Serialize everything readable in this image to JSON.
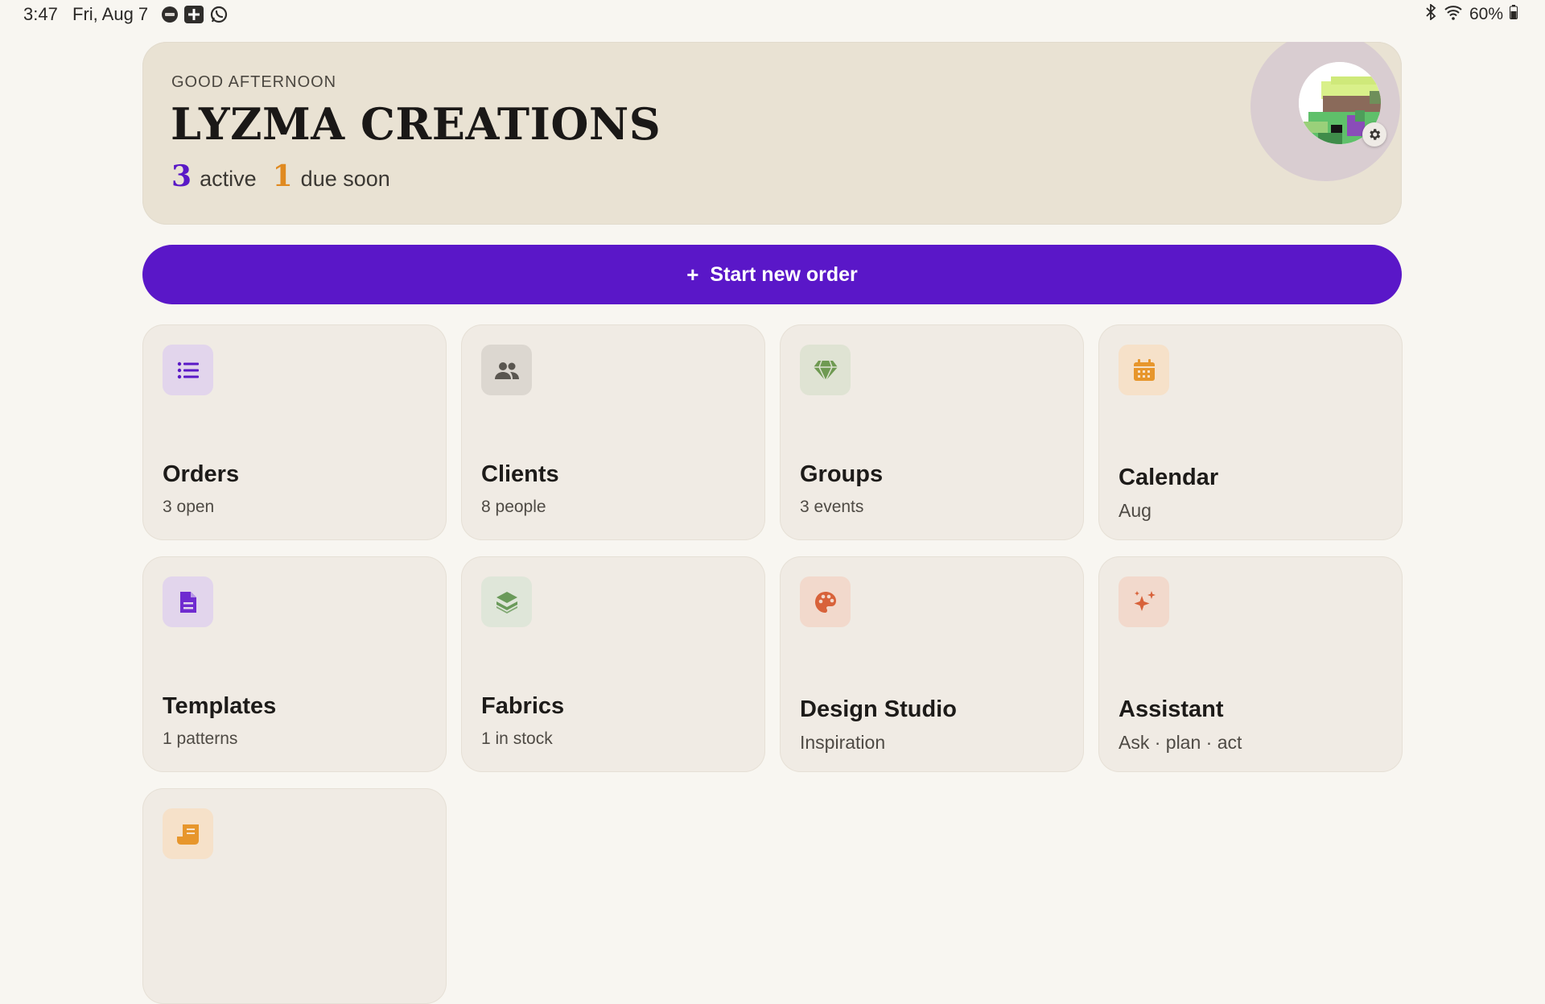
{
  "status_bar": {
    "time": "3:47",
    "date": "Fri, Aug 7",
    "battery": "60%",
    "left_icons": [
      "news-icon",
      "plus-box-icon",
      "whatsapp-icon"
    ],
    "right_icons": [
      "bluetooth-icon",
      "wifi-icon",
      "battery-icon"
    ]
  },
  "header": {
    "greeting": "GOOD AFTERNOON",
    "business_name": "LYZMA CREATIONS",
    "active_count": "3",
    "active_label": "active",
    "due_count": "1",
    "due_label": "due soon"
  },
  "primary_action": {
    "icon": "+",
    "label": "Start new order"
  },
  "tiles": [
    {
      "title": "Orders",
      "subtitle": "3 open",
      "icon": "list-icon",
      "color": "#5a19c6"
    },
    {
      "title": "Clients",
      "subtitle": "8 people",
      "icon": "people-icon",
      "color": "#5a5650"
    },
    {
      "title": "Groups",
      "subtitle": "3 events",
      "icon": "diamond-icon",
      "color": "#6f9a52"
    },
    {
      "title": "Calendar",
      "subtitle": "Aug",
      "icon": "calendar-icon",
      "color": "#e7962c"
    },
    {
      "title": "Templates",
      "subtitle": "1 patterns",
      "icon": "document-icon",
      "color": "#6f2bd0"
    },
    {
      "title": "Fabrics",
      "subtitle": "1 in stock",
      "icon": "layers-icon",
      "color": "#6a9a5a"
    },
    {
      "title": "Design Studio",
      "subtitle": "Inspiration",
      "icon": "palette-icon",
      "color": "#d8623a"
    },
    {
      "title": "Assistant",
      "subtitle": "Ask · plan · act",
      "icon": "sparkle-icon",
      "color": "#d8623a"
    },
    {
      "title": "",
      "subtitle": "",
      "icon": "receipt-icon",
      "color": "#e7962c"
    }
  ],
  "colors": {
    "accent": "#5a17c8",
    "due_accent": "#e08a20",
    "background": "#f8f6f1",
    "header_bg": "#e9e2d3"
  }
}
